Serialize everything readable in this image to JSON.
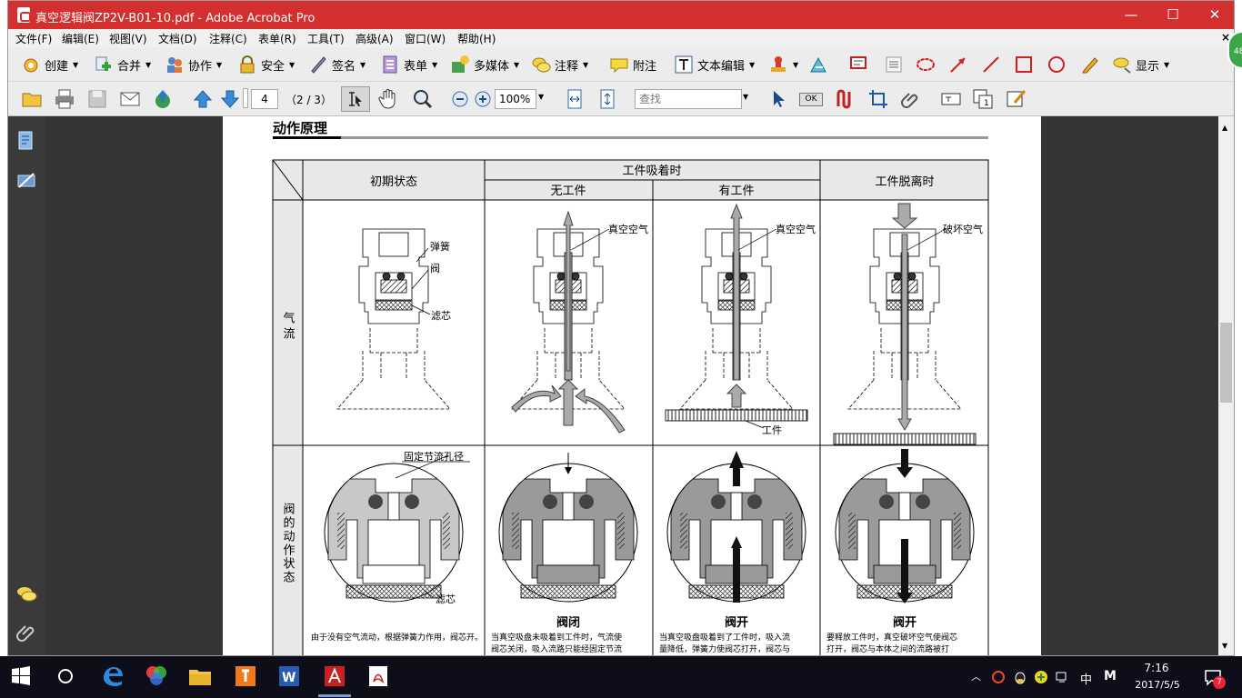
{
  "window": {
    "title": "真空逻辑阀ZP2V-B01-10.pdf - Adobe Acrobat Pro",
    "minimize": "—",
    "maximize": "☐",
    "close": "✕"
  },
  "menu": [
    "文件(F)",
    "编辑(E)",
    "视图(V)",
    "文档(D)",
    "注释(C)",
    "表单(R)",
    "工具(T)",
    "高级(A)",
    "窗口(W)",
    "帮助(H)"
  ],
  "menu_close": "×",
  "toolbar1": {
    "create": "创建",
    "combine": "合并",
    "collaborate": "协作",
    "secure": "安全",
    "sign": "签名",
    "forms": "表单",
    "multimedia": "多媒体",
    "comment": "注释",
    "note": "附注",
    "text_edit": "文本编辑",
    "show": "显示"
  },
  "toolbar2": {
    "page_current": "4",
    "page_total": "（2 / 3）",
    "zoom": "100%",
    "find_placeholder": "查找",
    "ok_btn": "OK"
  },
  "right_tab_badge": "48",
  "document": {
    "heading": "动作原理",
    "col_initial": "初期状态",
    "col_adsorb": "工件吸着时",
    "col_no_work": "无工件",
    "col_with_work": "有工件",
    "col_release": "工件脱离时",
    "row_airflow": "气流",
    "row_valve": "阀的动作状态",
    "labels": {
      "spring": "弹簧",
      "valve": "阀",
      "filter": "滤芯",
      "vacuum_air_1": "真空空气",
      "vacuum_air_2": "真空空气",
      "break_air": "破坏空气",
      "workpiece": "工件",
      "fixed_orifice": "固定节流孔径",
      "filter_2": "滤芯"
    },
    "state_closed": "阀闭",
    "state_open_1": "阀开",
    "state_open_2": "阀开",
    "desc_1": "由于没有空气流动，根据弹簧力作用，阀芯开。",
    "desc_2a": "当真空吸盘未吸着到工件时，气流使",
    "desc_2b": "阀芯关闭，吸入流路只能经固定节流",
    "desc_3a": "当真空吸盘吸着到了工件时，吸入流",
    "desc_3b": "量降低，弹簧力使阀芯打开，阀芯与",
    "desc_4a": "要释放工件时，真空破坏空气使阀芯",
    "desc_4b": "打开，阀芯与本体之间的流路被打"
  },
  "taskbar": {
    "time": "7:16",
    "date": "2017/5/5",
    "ime": "中",
    "notif_count": "7"
  },
  "colors": {
    "titlebar": "#d32f2f",
    "viewer_bg": "#353535",
    "taskbar": "#0e0e1a"
  }
}
